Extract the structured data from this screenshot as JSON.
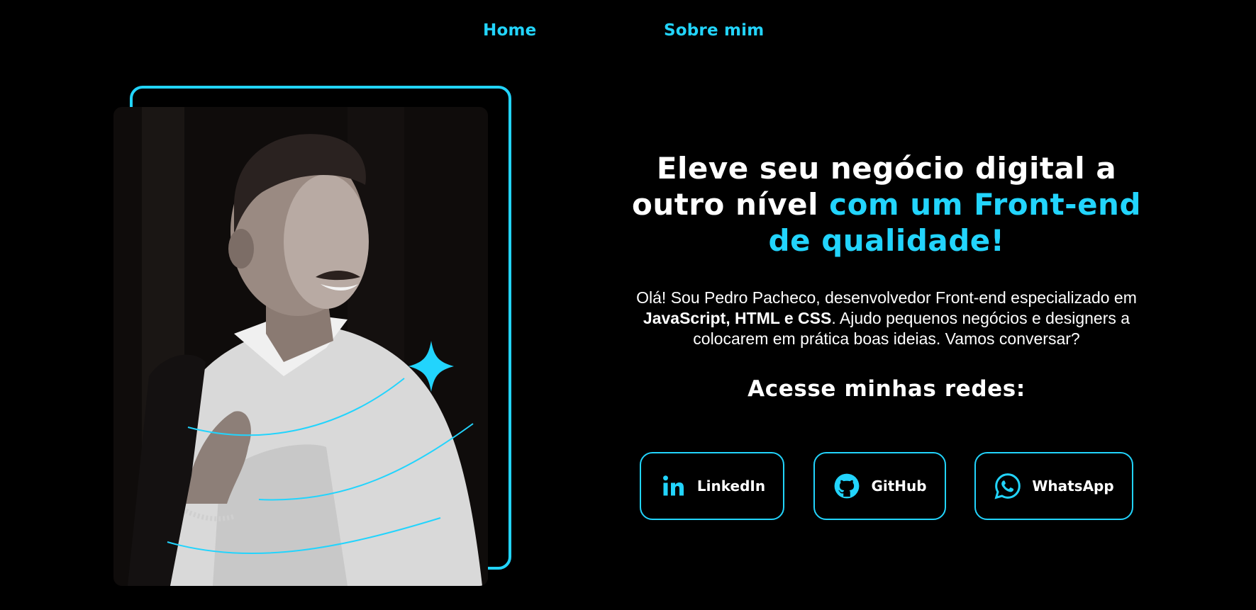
{
  "nav": {
    "home_label": "Home",
    "about_label": "Sobre mim"
  },
  "hero": {
    "headline_white": "Eleve seu negócio digital a outro nível",
    "headline_accent": "com um Front-end de qualidade!",
    "intro_part1": "Olá! Sou Pedro Pacheco, desenvolvedor Front-end especializado em",
    "intro_bold": "JavaScript, HTML e CSS",
    "intro_part2": ". Ajudo pequenos negócios e designers a colocarem em prática boas ideias. Vamos conversar?",
    "networks_title": "Acesse minhas redes:"
  },
  "social": {
    "linkedin_label": "LinkedIn",
    "github_label": "GitHub",
    "whatsapp_label": "WhatsApp"
  },
  "colors": {
    "background": "#000000",
    "accent": "#22d4fd",
    "text": "#ffffff"
  },
  "icons": {
    "linkedin": "linkedin-icon",
    "github": "github-icon",
    "whatsapp": "whatsapp-icon",
    "sparkle": "sparkle-icon"
  }
}
